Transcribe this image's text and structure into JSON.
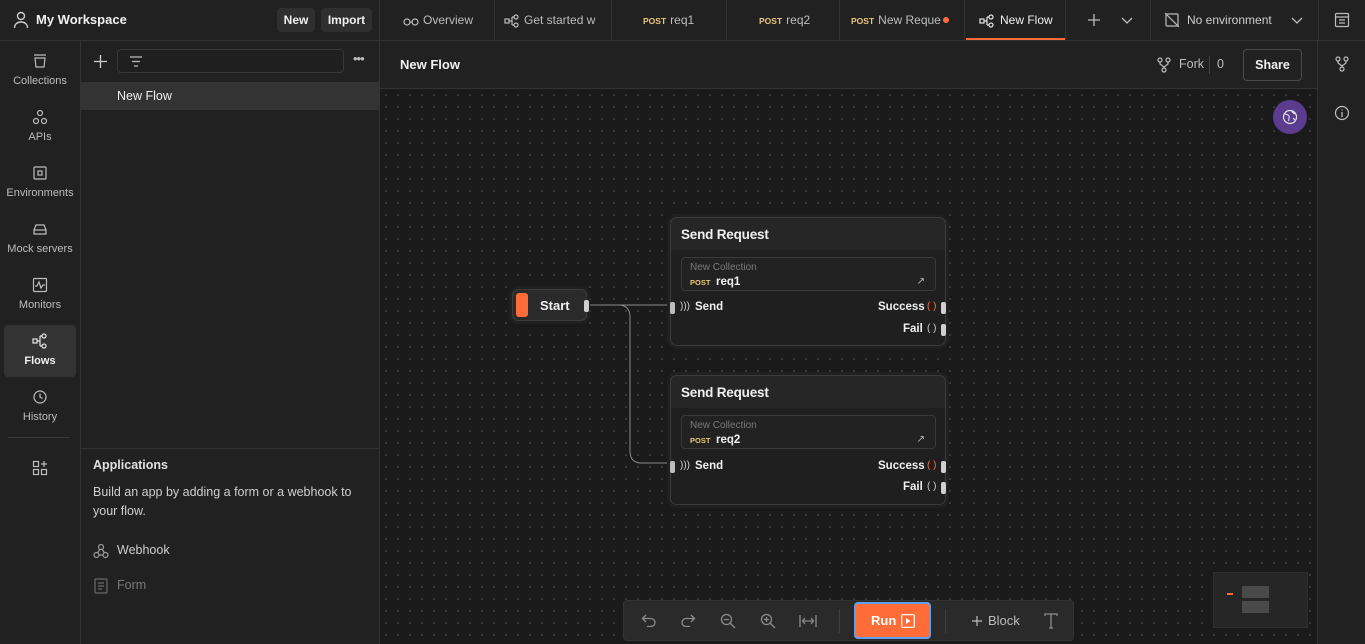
{
  "workspace": {
    "name": "My Workspace",
    "new_label": "New",
    "import_label": "Import"
  },
  "tabs": [
    {
      "label": "Overview",
      "method": ""
    },
    {
      "label": "Get started w",
      "method": ""
    },
    {
      "label": "req1",
      "method": "POST"
    },
    {
      "label": "req2",
      "method": "POST"
    },
    {
      "label": "New Reque",
      "method": "POST"
    },
    {
      "label": "New Flow",
      "method": ""
    }
  ],
  "environment": {
    "selected": "No environment"
  },
  "rail": [
    {
      "label": "Collections",
      "icon": "collections-icon"
    },
    {
      "label": "APIs",
      "icon": "apis-icon"
    },
    {
      "label": "Environments",
      "icon": "environments-icon"
    },
    {
      "label": "Mock servers",
      "icon": "mock-servers-icon"
    },
    {
      "label": "Monitors",
      "icon": "monitors-icon"
    },
    {
      "label": "Flows",
      "icon": "flows-icon"
    },
    {
      "label": "History",
      "icon": "history-icon"
    }
  ],
  "sidebar": {
    "flows": [
      {
        "label": "New Flow"
      }
    ],
    "applications": {
      "title": "Applications",
      "description": "Build an app by adding a form or a webhook to your flow.",
      "webhook_label": "Webhook",
      "form_label": "Form"
    }
  },
  "canvas": {
    "title": "New Flow",
    "fork_label": "Fork",
    "fork_count": "0",
    "share_label": "Share"
  },
  "flow": {
    "start_label": "Start",
    "blocks": [
      {
        "title": "Send Request",
        "collection": "New Collection",
        "method": "POST",
        "request": "req1",
        "input_label": "Send",
        "success_label": "Success",
        "fail_label": "Fail"
      },
      {
        "title": "Send Request",
        "collection": "New Collection",
        "method": "POST",
        "request": "req2",
        "input_label": "Send",
        "success_label": "Success",
        "fail_label": "Fail"
      }
    ]
  },
  "toolbar": {
    "run_label": "Run",
    "block_label": "Block"
  },
  "colors": {
    "accent": "#ff6c37",
    "method_post": "#e8c778",
    "active_tab_dot": "#ff6c37"
  }
}
